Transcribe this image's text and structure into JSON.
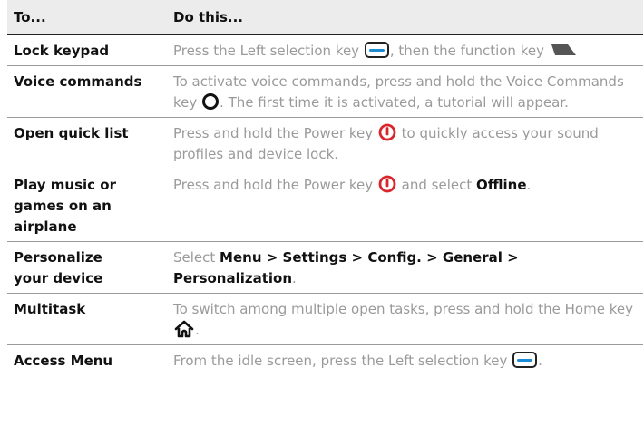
{
  "header": {
    "col1": "To...",
    "col2": "Do this..."
  },
  "rows": [
    {
      "task": "Lock keypad",
      "d1": "Press the Left selection key ",
      "d2": ", then the function key "
    },
    {
      "task": "Voice commands",
      "d1": "To activate voice commands, press and hold the Voice Commands key ",
      "d2": ". The first time it is activated, a tutorial will appear."
    },
    {
      "task": "Open quick list",
      "d1": "Press and hold the Power key ",
      "d2": " to quickly access your sound profiles and device lock."
    },
    {
      "task": "Play music or games on an airplane",
      "d1": "Press and hold the Power key ",
      "d2": " and select ",
      "b1": "Offline",
      "d3": "."
    },
    {
      "task": "Personalize your device",
      "d1": "Select ",
      "b1": "Menu > Settings > Config. > General > Personalization",
      "d2": "."
    },
    {
      "task": "Multitask",
      "d1": "To switch among multiple open tasks, press and hold the Home key ",
      "d2": "."
    },
    {
      "task": "Access Menu",
      "d1": "From the idle screen, press the Left selection key ",
      "d2": "."
    }
  ],
  "icons": {
    "selection": "left-selection-key-icon",
    "function": "function-key-icon",
    "voice": "voice-commands-key-icon",
    "power": "power-key-icon",
    "home": "home-key-icon"
  },
  "colors": {
    "power": "#d9262c",
    "selection_accent": "#1b8bd6",
    "description_text": "#9a9a9a"
  }
}
